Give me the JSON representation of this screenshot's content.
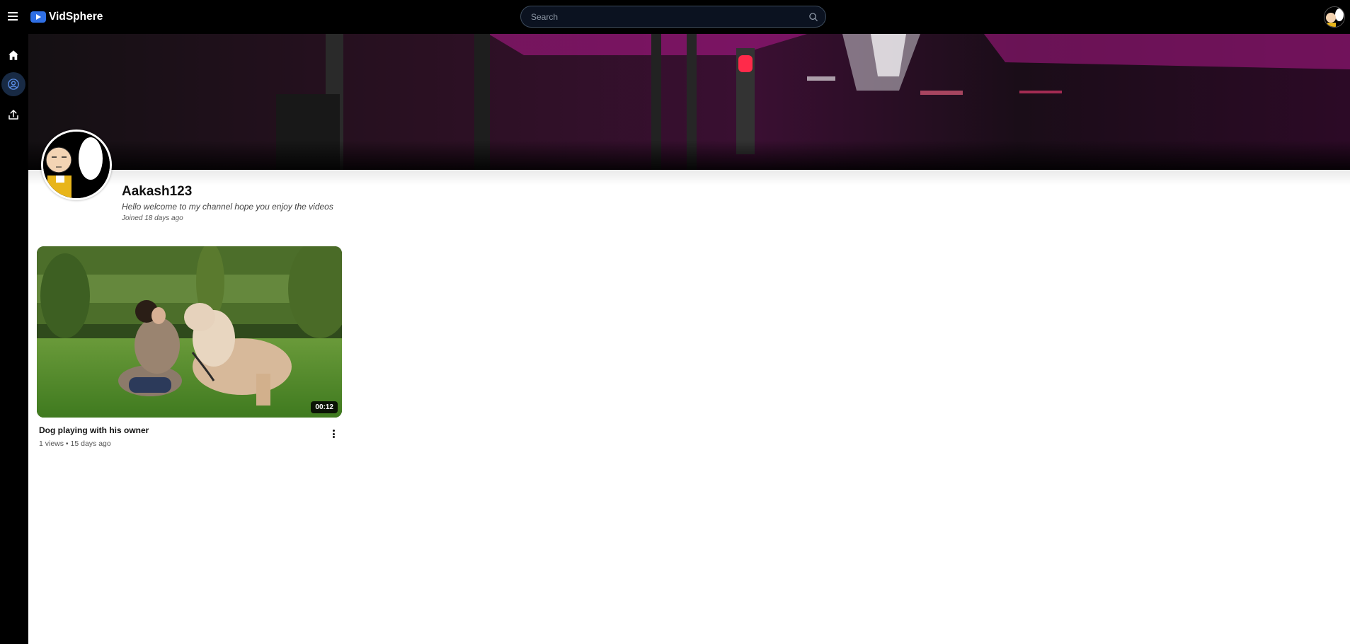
{
  "header": {
    "app_name": "VidSphere",
    "search_placeholder": "Search"
  },
  "sidebar": {
    "items": [
      {
        "icon": "home-icon",
        "label": "Home"
      },
      {
        "icon": "user-circle-icon",
        "label": "Your channel",
        "active": true
      },
      {
        "icon": "upload-icon",
        "label": "Upload"
      }
    ]
  },
  "channel": {
    "name": "Aakash123",
    "description": "Hello welcome to my channel hope you enjoy the videos",
    "joined": "Joined 18 days ago"
  },
  "videos": [
    {
      "title": "Dog playing with his owner",
      "meta": "1 views • 15 days ago",
      "duration": "00:12"
    }
  ],
  "colors": {
    "brand": "#2f6fe4",
    "topbar": "#000000",
    "active_nav": "#182a44"
  }
}
